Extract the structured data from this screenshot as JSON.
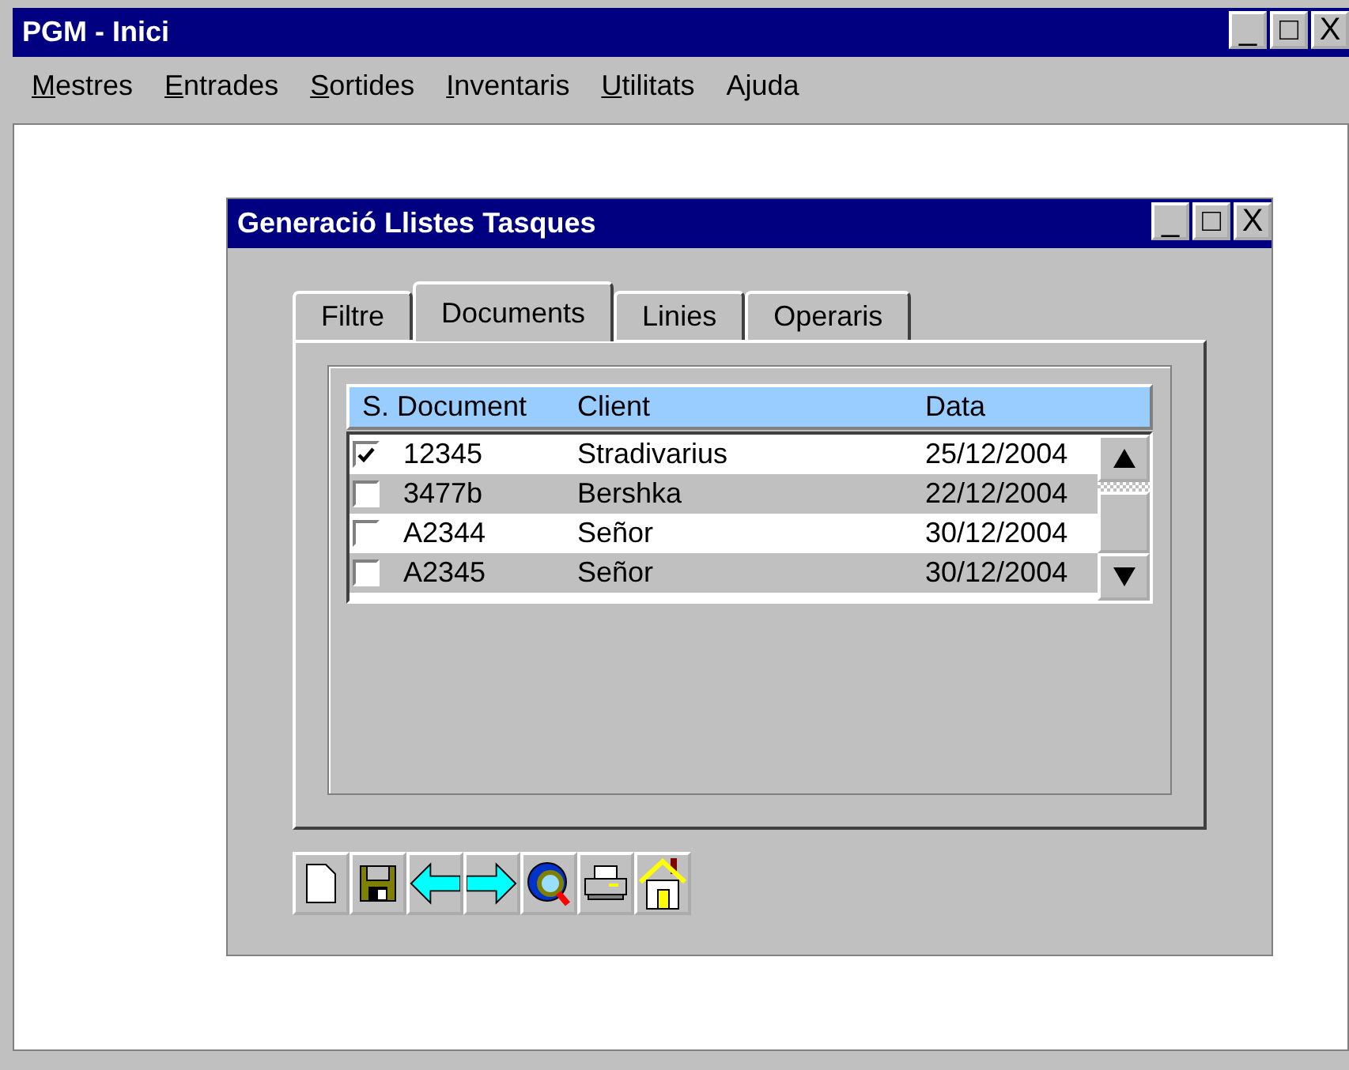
{
  "window": {
    "title": "PGM - Inici",
    "controls": [
      "_",
      "□",
      "X"
    ]
  },
  "menu": [
    {
      "label": "Mestres",
      "underline_first": true
    },
    {
      "label": "Entrades",
      "underline_first": true
    },
    {
      "label": "Sortides",
      "underline_first": true
    },
    {
      "label": "Inventaris",
      "underline_first": true
    },
    {
      "label": "Utilitats",
      "underline_first": true
    },
    {
      "label": "Ajuda",
      "underline_first": false
    }
  ],
  "dialog": {
    "title": "Generació Llistes Tasques",
    "controls": [
      "_",
      "□",
      "X"
    ],
    "tabs": [
      {
        "label": "Filtre",
        "selected": false
      },
      {
        "label": "Documents",
        "selected": true
      },
      {
        "label": "Linies",
        "selected": false
      },
      {
        "label": "Operaris",
        "selected": false
      }
    ],
    "table": {
      "columns": [
        "S. Document",
        "Client",
        "Data"
      ],
      "rows": [
        {
          "checked": true,
          "document": "12345",
          "client": "Stradivarius",
          "data": "25/12/2004"
        },
        {
          "checked": false,
          "document": "3477b",
          "client": "Bershka",
          "data": "22/12/2004"
        },
        {
          "checked": false,
          "document": "A2344",
          "client": "Señor",
          "data": "30/12/2004"
        },
        {
          "checked": false,
          "document": "A2345",
          "client": "Señor",
          "data": "30/12/2004"
        }
      ]
    },
    "toolbar": [
      {
        "kind": "new"
      },
      {
        "kind": "save"
      },
      {
        "kind": "back"
      },
      {
        "kind": "forward"
      },
      {
        "kind": "search"
      },
      {
        "kind": "print"
      },
      {
        "kind": "home"
      }
    ]
  }
}
